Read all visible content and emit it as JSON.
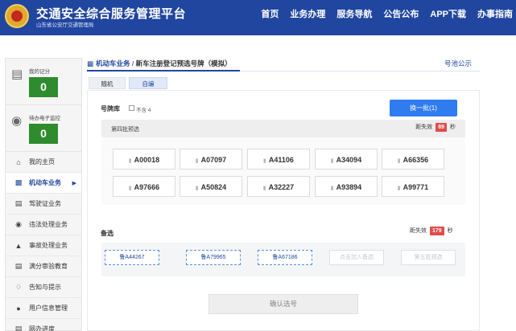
{
  "header": {
    "title": "交通安全综合服务管理平台",
    "subtitle": "山东省公安厅交通管理局",
    "nav": [
      "首页",
      "业务办理",
      "服务导航",
      "公告公布",
      "APP下载",
      "办事指南"
    ]
  },
  "sidebar": {
    "cards": [
      {
        "label": "我的记分",
        "value": "0",
        "icon": "scorecard-icon"
      },
      {
        "label": "待办电子监控",
        "value": "0",
        "icon": "traffic-camera-icon"
      }
    ],
    "menu": [
      {
        "label": "我的主页",
        "icon": "home-icon"
      },
      {
        "label": "机动车业务",
        "icon": "car-icon",
        "active": true
      },
      {
        "label": "驾驶证业务",
        "icon": "license-icon"
      },
      {
        "label": "违法处理业务",
        "icon": "camera-icon"
      },
      {
        "label": "事故处理业务",
        "icon": "warning-icon"
      },
      {
        "label": "满分审验教育",
        "icon": "education-icon"
      },
      {
        "label": "告知与提示",
        "icon": "bell-icon"
      },
      {
        "label": "用户信息管理",
        "icon": "user-icon"
      },
      {
        "label": "网办进度",
        "icon": "progress-icon"
      }
    ]
  },
  "breadcrumb": {
    "section": "机动车业务",
    "separator": " / ",
    "current": "新车注册登记预选号牌（模拟）",
    "notice": "号池公示"
  },
  "tabs": [
    "随机",
    "自编"
  ],
  "plate_library": {
    "label": "号牌库",
    "exclude_label": "不含 4",
    "swap_button": "换一批(1)"
  },
  "batch": {
    "title": "第四批预选",
    "expire_prefix": "距失效",
    "expire_value": "89",
    "expire_unit": "秒",
    "plates": [
      "A00018",
      "A07097",
      "A41106",
      "A34094",
      "A66356",
      "A97666",
      "A50824",
      "A32227",
      "A93894",
      "A99771"
    ]
  },
  "reserve": {
    "label": "备选",
    "expire_prefix": "距失效",
    "expire_value": "179",
    "expire_unit": "秒",
    "slots": [
      {
        "text": "鲁A44267",
        "filled": true
      },
      {
        "text": "鲁A79965",
        "filled": true
      },
      {
        "text": "鲁A67186",
        "filled": true
      },
      {
        "text": "点击加入备选",
        "filled": false
      },
      {
        "text": "第五批预选",
        "filled": false
      }
    ]
  },
  "confirm_button": "确认选号",
  "colors": {
    "header_blue": "#2146a0",
    "button_blue": "#2f7cf0",
    "badge_green": "#2e8b2e",
    "alert_red": "#e44a4a"
  }
}
